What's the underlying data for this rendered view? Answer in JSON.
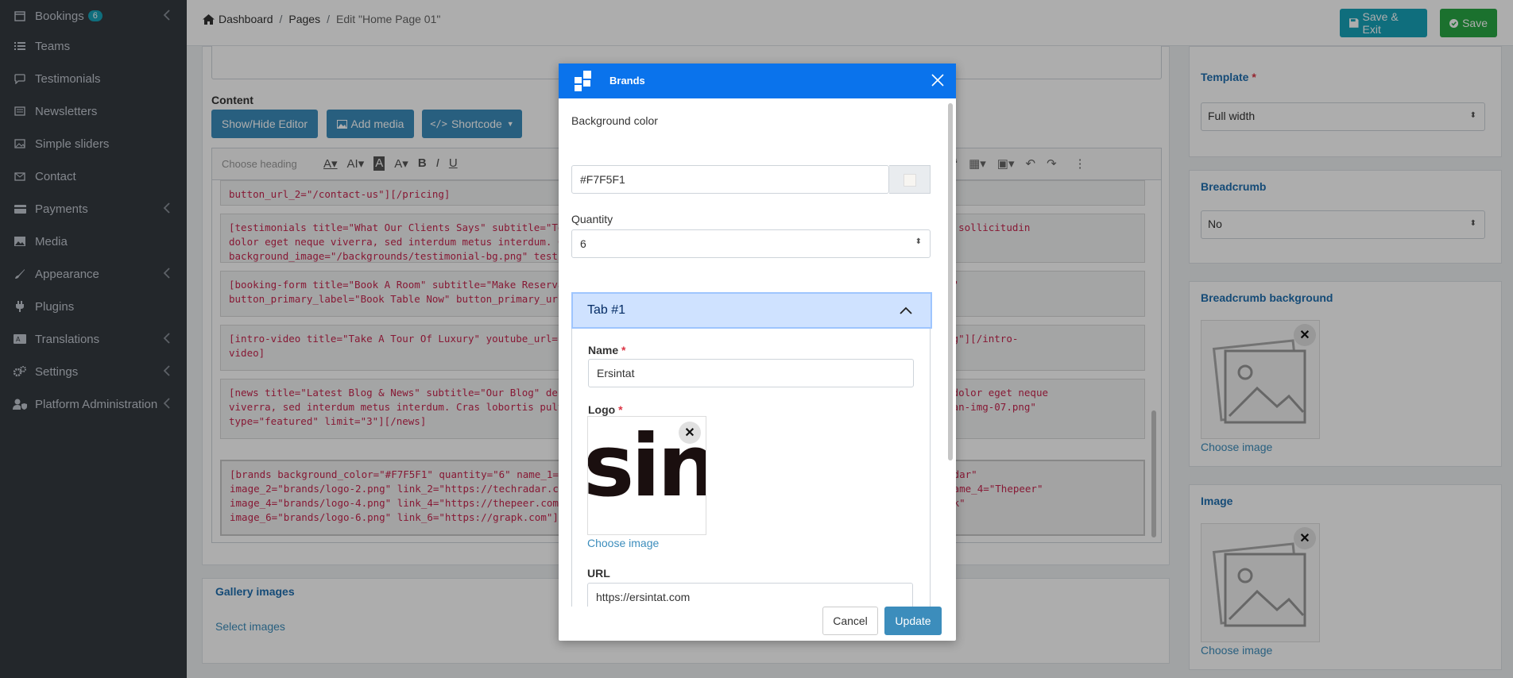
{
  "sidebar": {
    "items": [
      {
        "label": "Bookings",
        "icon": "calendar-icon",
        "badge": "6",
        "chevron": true
      },
      {
        "label": "Teams",
        "icon": "list-icon"
      },
      {
        "label": "Testimonials",
        "icon": "comment-icon"
      },
      {
        "label": "Newsletters",
        "icon": "newspaper-icon"
      },
      {
        "label": "Simple sliders",
        "icon": "image-icon"
      },
      {
        "label": "Contact",
        "icon": "envelope-icon"
      },
      {
        "label": "Payments",
        "icon": "card-icon",
        "chevron": true
      },
      {
        "label": "Media",
        "icon": "photo-icon"
      },
      {
        "label": "Appearance",
        "icon": "brush-icon",
        "chevron": true
      },
      {
        "label": "Plugins",
        "icon": "plug-icon"
      },
      {
        "label": "Translations",
        "icon": "language-icon",
        "chevron": true
      },
      {
        "label": "Settings",
        "icon": "gears-icon",
        "chevron": true
      },
      {
        "label": "Platform Administration",
        "icon": "user-shield-icon",
        "chevron": true
      }
    ]
  },
  "topbar": {
    "breadcrumb": [
      "Dashboard",
      "Pages",
      "Edit \"Home Page 01\""
    ],
    "save_exit_label": "Save & Exit",
    "save_label": "Save"
  },
  "editor": {
    "content_label": "Content",
    "show_hide_label": "Show/Hide Editor",
    "add_media_label": "Add media",
    "shortcode_label": "Shortcode",
    "heading_placeholder": "Choose heading",
    "blocks": [
      "button_url_2=\"/contact-us\"][/pricing]",
      "[testimonials title=\"What Our Clients Says\" subtitle=\"Tes                                                    Pellentesque sollicitudin\ndolor eget neque viverra, sed interdum metus interdum. Cr\nbackground_image=\"/backgrounds/testimonial-bg.png\" testim",
      "[booking-form title=\"Book A Room\" subtitle=\"Make Reservat                                                   an-img-01.png\"\nbutton_primary_label=\"Book Table Now\" button_primary_url=",
      "[intro-video title=\"Take A Tour Of Luxury\" youtube_url=\"h                                                  al/video-bg.png\"][/intro-\nvideo]",
      "[news title=\"Latest Blog & News\" subtitle=\"Our Blog\" desc                                                   sollicitudin dolor eget neque\nviverra, sed interdum metus interdum. Cras lobortis pulvi                                                  =\"backgrounds/an-img-07.png\"\ntype=\"featured\" limit=\"3\"][/news]",
      "[brands background_color=\"#F7F5F1\" quantity=\"6\" name_1=\"E                                                  name_2=\"Techradar\"\nimage_2=\"brands/logo-2.png\" link_2=\"https://techradar.com                                                  rbologo.com\" name_4=\"Thepeer\"\nimage_4=\"brands/logo-4.png\" link_4=\"https://thepeer.com\"                                                  \" name_6=\"Grapik\"\nimage_6=\"brands/logo-6.png\" link_6=\"https://grapk.com\"][/"
    ]
  },
  "gallery": {
    "title": "Gallery images",
    "select_label": "Select images"
  },
  "right_panel": {
    "template_title": "Template",
    "template_value": "Full width",
    "breadcrumb_title": "Breadcrumb",
    "breadcrumb_value": "No",
    "breadcrumb_bg_title": "Breadcrumb background",
    "choose_image_label": "Choose image",
    "image_title": "Image"
  },
  "modal": {
    "title": "Brands",
    "bg_color_label": "Background color",
    "bg_color_value": "#F7F5F1",
    "quantity_label": "Quantity",
    "quantity_value": "6",
    "tab_label": "Tab #1",
    "name_label": "Name",
    "name_value": "Ersintat",
    "logo_label": "Logo",
    "logo_text": "sin",
    "choose_image_label": "Choose image",
    "url_label": "URL",
    "url_value": "https://ersintat.com",
    "cancel_label": "Cancel",
    "update_label": "Update"
  },
  "colors": {
    "sidebar_bg": "#343a40",
    "modal_header": "#0a73ec",
    "primary": "#3c8dbc",
    "save_exit": "#17a2b8",
    "save": "#28a745",
    "shortcode_text": "#c7254e"
  }
}
